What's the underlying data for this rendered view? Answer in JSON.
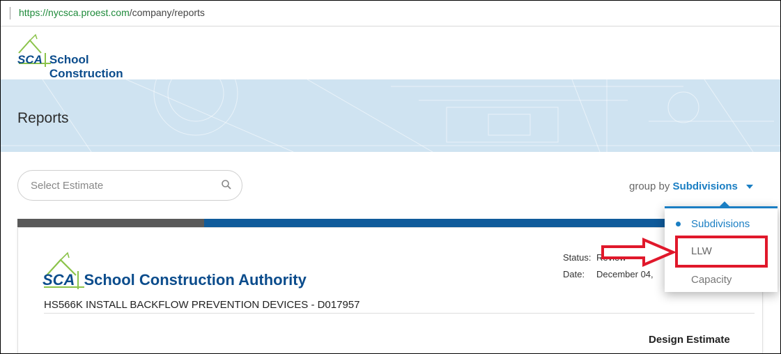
{
  "browser": {
    "url_prefix": "https://",
    "url_host": "nycsca.proest.com",
    "url_path": "/company/reports"
  },
  "header": {
    "brand_mark": "SCA",
    "brand_name": "School Construction Authority"
  },
  "banner": {
    "title": "Reports"
  },
  "search": {
    "placeholder": "Select Estimate"
  },
  "groupby": {
    "label": "group by",
    "value": "Subdivisions"
  },
  "dropdown": {
    "items": [
      {
        "label": "Subdivisions"
      },
      {
        "label": "LLW"
      },
      {
        "label": "Capacity"
      }
    ]
  },
  "report": {
    "brand_mark": "SCA",
    "brand_name": "School Construction Authority",
    "status_label": "Status:",
    "status_value": "Review",
    "date_label": "Date:",
    "date_value": "December 04,",
    "project": "HS566K INSTALL BACKFLOW PREVENTION DEVICES - D017957",
    "doc_type": "Design Estimate"
  },
  "colors": {
    "accent": "#1a7ec3",
    "brand": "#0b4c8c",
    "highlight": "#e0182b",
    "banner": "#cfe3f1"
  }
}
